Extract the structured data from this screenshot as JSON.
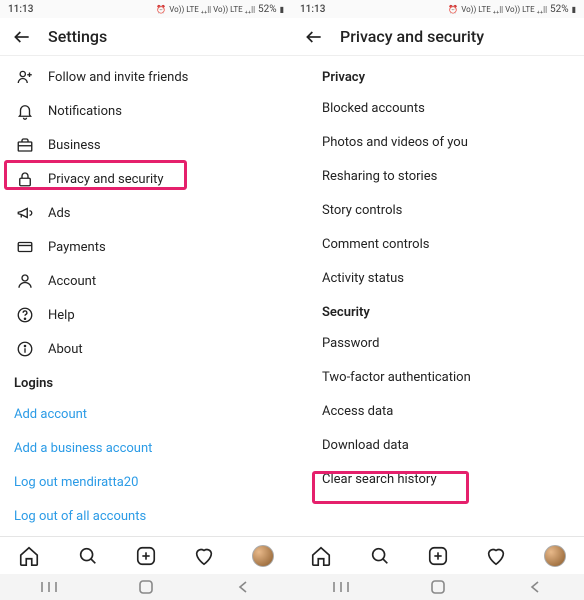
{
  "status": {
    "time": "11:13",
    "battery": "52%"
  },
  "left": {
    "title": "Settings",
    "items": [
      {
        "label": "Follow and invite friends"
      },
      {
        "label": "Notifications"
      },
      {
        "label": "Business"
      },
      {
        "label": "Privacy and security"
      },
      {
        "label": "Ads"
      },
      {
        "label": "Payments"
      },
      {
        "label": "Account"
      },
      {
        "label": "Help"
      },
      {
        "label": "About"
      }
    ],
    "logins_header": "Logins",
    "links": [
      "Add account",
      "Add a business account",
      "Log out mendiratta20",
      "Log out of all accounts"
    ]
  },
  "right": {
    "title": "Privacy and security",
    "privacy_header": "Privacy",
    "privacy_items": [
      "Blocked accounts",
      "Photos and videos of you",
      "Resharing to stories",
      "Story controls",
      "Comment controls",
      "Activity status"
    ],
    "security_header": "Security",
    "security_items": [
      "Password",
      "Two-factor authentication",
      "Access data",
      "Download data",
      "Clear search history"
    ]
  }
}
